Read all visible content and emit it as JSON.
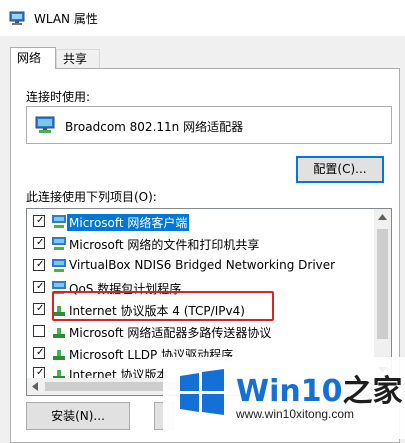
{
  "window": {
    "title": "WLAN 属性"
  },
  "tabs": [
    {
      "label": "网络"
    },
    {
      "label": "共享"
    }
  ],
  "connect_using": {
    "label": "连接时使用:",
    "adapter": "Broadcom 802.11n 网络适配器",
    "configure_button": "配置(C)..."
  },
  "items_section": {
    "label": "此连接使用下列项目(O):",
    "items": [
      {
        "label": "Microsoft 网络客户端",
        "checked": true,
        "selected": true,
        "icon": "network-client-icon"
      },
      {
        "label": "Microsoft 网络的文件和打印机共享",
        "checked": true,
        "selected": false,
        "icon": "network-share-icon"
      },
      {
        "label": "VirtualBox NDIS6 Bridged Networking Driver",
        "checked": true,
        "selected": false,
        "icon": "network-driver-icon"
      },
      {
        "label": "QoS 数据包计划程序",
        "checked": true,
        "selected": false,
        "icon": "network-qos-icon"
      },
      {
        "label": "Internet 协议版本 4 (TCP/IPv4)",
        "checked": true,
        "selected": false,
        "icon": "protocol-icon"
      },
      {
        "label": "Microsoft 网络适配器多路传送器协议",
        "checked": false,
        "selected": false,
        "icon": "protocol-icon"
      },
      {
        "label": "Microsoft LLDP 协议驱动程序",
        "checked": true,
        "selected": false,
        "icon": "protocol-icon"
      },
      {
        "label": "Internet 协议版本",
        "checked": true,
        "selected": false,
        "icon": "protocol-icon"
      }
    ]
  },
  "buttons": {
    "install": "安装(N)..."
  },
  "watermark": {
    "brand_en": "Win10",
    "brand_zh": "之家",
    "url": "www.win10xitong.com"
  },
  "colors": {
    "accent": "#0078d7",
    "highlight_border": "#dd2222",
    "logo_blue": "#1570d6"
  }
}
